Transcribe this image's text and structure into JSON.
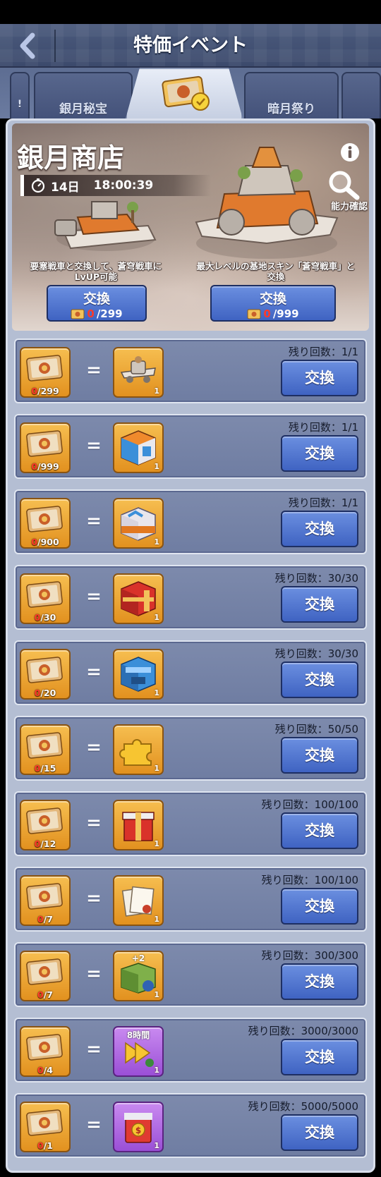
{
  "header": {
    "title": "特価イベント"
  },
  "tabs": [
    {
      "label": "!"
    },
    {
      "label": "銀月秘宝"
    },
    {
      "label": ""
    },
    {
      "label": "暗月祭り"
    },
    {
      "label": ""
    }
  ],
  "banner": {
    "title": "銀月商店",
    "timer_days": "14日",
    "timer_time": "18:00:39",
    "ability_label": "能力確認",
    "offers": [
      {
        "description": "要塞戦車と交換して、蒼穹戦車に LvUP可能",
        "button_label": "交換",
        "owned": "0",
        "required": "/299"
      },
      {
        "description": "最大レベルの基地スキン「蒼穹戦車」と交換",
        "button_label": "交換",
        "owned": "0",
        "required": "/999"
      }
    ]
  },
  "exchange_rows": [
    {
      "owned": "0",
      "cost": "/299",
      "reward": "plane",
      "qty": "1",
      "remaining": "残り回数：1/1",
      "button": "交換"
    },
    {
      "owned": "0",
      "cost": "/999",
      "reward": "cube",
      "qty": "1",
      "remaining": "残り回数：1/1",
      "button": "交換"
    },
    {
      "owned": "0",
      "cost": "/900",
      "reward": "chest",
      "qty": "1",
      "remaining": "残り回数：1/1",
      "button": "交換"
    },
    {
      "owned": "0",
      "cost": "/30",
      "reward": "red-crate",
      "qty": "1",
      "remaining": "残り回数：30/30",
      "button": "交換"
    },
    {
      "owned": "0",
      "cost": "/20",
      "reward": "blue-crate",
      "qty": "1",
      "remaining": "残り回数：30/30",
      "button": "交換"
    },
    {
      "owned": "0",
      "cost": "/15",
      "reward": "puzzle",
      "qty": "1",
      "remaining": "残り回数：50/50",
      "button": "交換"
    },
    {
      "owned": "0",
      "cost": "/12",
      "reward": "gift-box",
      "qty": "1",
      "remaining": "残り回数：100/100",
      "button": "交換"
    },
    {
      "owned": "0",
      "cost": "/7",
      "reward": "documents",
      "qty": "1",
      "remaining": "残り回数：100/100",
      "button": "交換"
    },
    {
      "owned": "0",
      "cost": "/7",
      "reward": "plus2-kit",
      "reward_text": "+2",
      "qty": "1",
      "remaining": "残り回数：300/300",
      "button": "交換"
    },
    {
      "owned": "0",
      "cost": "/4",
      "reward": "speedup-8h",
      "reward_text": "8時間",
      "qty": "1",
      "remaining": "残り回数：3000/3000",
      "button": "交換"
    },
    {
      "owned": "0",
      "cost": "/1",
      "reward": "red-packet",
      "qty": "1",
      "remaining": "残り回数：5000/5000",
      "button": "交換"
    }
  ],
  "colors": {
    "header_bg": "#4b5a7d",
    "panel_bg": "#b4bed3",
    "row_bg": "#7d8aac",
    "button_blue": "#3f63c2",
    "card_gold": "#f0a93a",
    "card_purple": "#b16de6",
    "owned_red": "#ff3a2a"
  }
}
